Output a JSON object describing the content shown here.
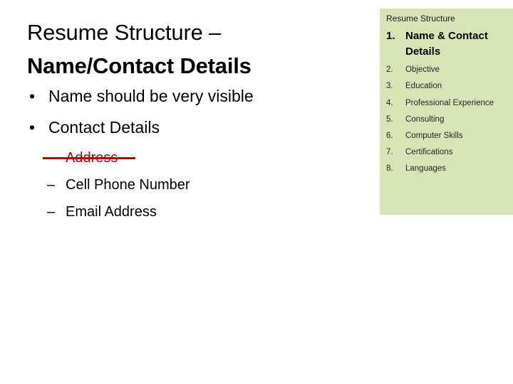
{
  "slide": {
    "title": {
      "line1": "Resume Structure –",
      "line2": "Name/Contact Details"
    },
    "bullets": [
      {
        "level": 1,
        "marker": "•",
        "text": "Name should be very visible"
      },
      {
        "level": 1,
        "marker": "•",
        "text": "Contact Details"
      },
      {
        "level": 2,
        "marker": "–",
        "text": "Address",
        "struck": true
      },
      {
        "level": 2,
        "marker": "–",
        "text": "Cell Phone Number",
        "struck": false
      },
      {
        "level": 2,
        "marker": "–",
        "text": "Email Address",
        "struck": false
      }
    ]
  },
  "sidebar": {
    "header": "Resume Structure",
    "items": [
      {
        "num": "1.",
        "label": "Name & Contact Details",
        "current": true
      },
      {
        "num": "2.",
        "label": "Objective",
        "current": false
      },
      {
        "num": "3.",
        "label": "Education",
        "current": false
      },
      {
        "num": "4.",
        "label": "Professional Experience",
        "current": false
      },
      {
        "num": "5.",
        "label": "Consulting",
        "current": false
      },
      {
        "num": "6.",
        "label": "Computer Skills",
        "current": false
      },
      {
        "num": "7.",
        "label": "Certifications",
        "current": false
      },
      {
        "num": "8.",
        "label": "Languages",
        "current": false
      }
    ]
  },
  "colors": {
    "panel_background": "#D7E4B5",
    "strike_red": "#C00000",
    "slide_background": "#FFFFFF",
    "text": "#000000"
  }
}
